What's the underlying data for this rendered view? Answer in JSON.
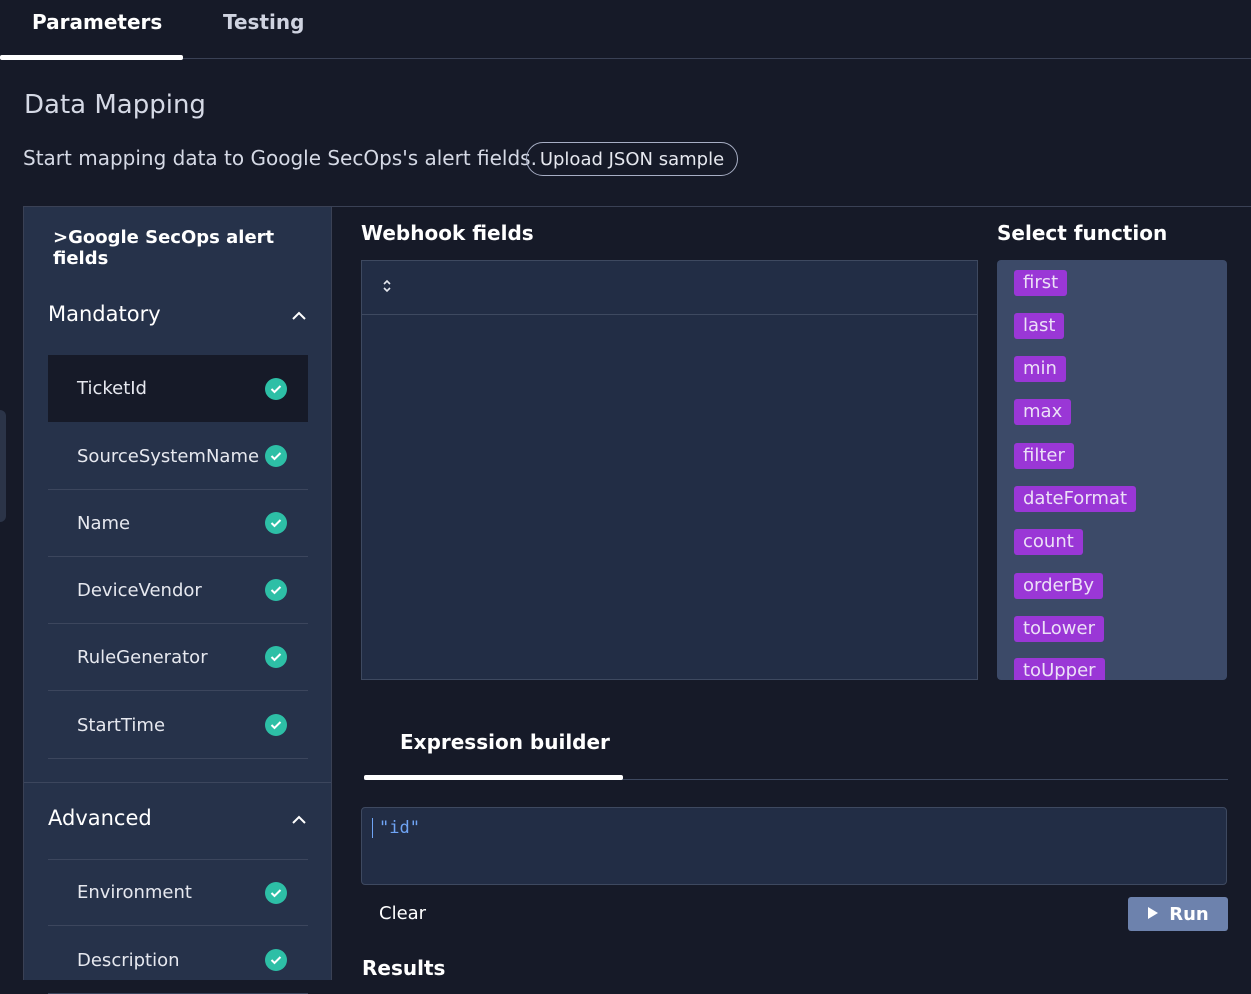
{
  "tabs": {
    "parameters": "Parameters",
    "testing": "Testing"
  },
  "section": {
    "title": "Data Mapping",
    "subtitle": "Start mapping data to Google SecOps's alert fields.",
    "upload_label": "Upload JSON sample"
  },
  "left_panel": {
    "title": ">Google SecOps alert fields",
    "mandatory": {
      "label": "Mandatory",
      "items": [
        "TicketId",
        "SourceSystemName",
        "Name",
        "DeviceVendor",
        "RuleGenerator",
        "StartTime"
      ]
    },
    "advanced": {
      "label": "Advanced",
      "items": [
        "Environment",
        "Description"
      ]
    }
  },
  "webhook": {
    "title": "Webhook fields"
  },
  "functions": {
    "title": "Select function",
    "items": [
      "first",
      "last",
      "min",
      "max",
      "filter",
      "dateFormat",
      "count",
      "orderBy",
      "toLower",
      "toUpper"
    ]
  },
  "expression": {
    "tab_label": "Expression builder",
    "value": "\"id\"",
    "clear_label": "Clear",
    "run_label": "Run"
  },
  "results": {
    "title": "Results"
  },
  "colors": {
    "background": "#161a28",
    "panel": "#26324a",
    "check": "#2dbfa6",
    "chip": "#9a37d6",
    "run_button": "#6d82ad",
    "expression_text": "#6fa4f5"
  }
}
